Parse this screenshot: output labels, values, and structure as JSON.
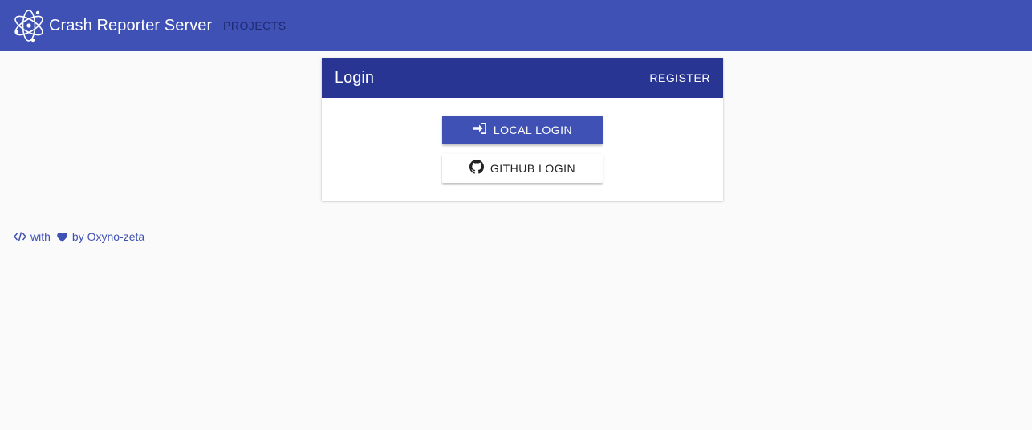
{
  "header": {
    "app_title": "Crash Reporter Server",
    "nav_projects": "PROJECTS",
    "logo_icon": "atom-logo-icon"
  },
  "login_card": {
    "title": "Login",
    "register_label": "REGISTER",
    "local_login_label": "LOCAL LOGIN",
    "local_login_icon": "sign-in-icon",
    "github_login_label": "GITHUB LOGIN",
    "github_login_icon": "github-icon"
  },
  "footer": {
    "code_icon": "code-icon",
    "with_text": "with",
    "heart_icon": "heart-icon",
    "by_text": "by Oxyno-zeta"
  },
  "colors": {
    "primary": "#3f51b5",
    "primary_dark": "#283593",
    "background": "#fafafa"
  }
}
